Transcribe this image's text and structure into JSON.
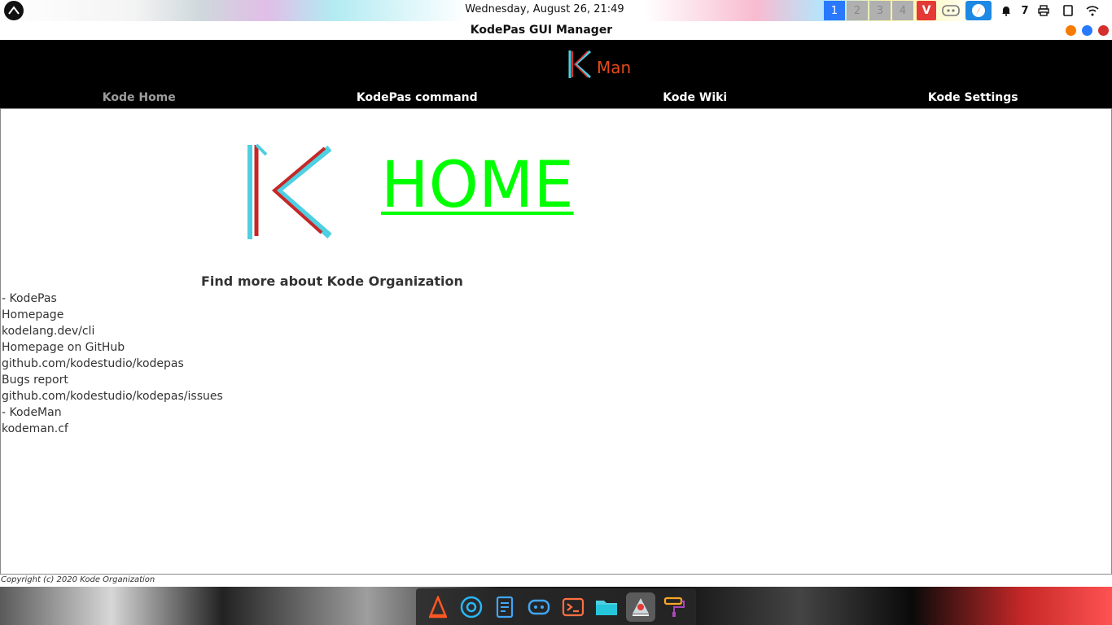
{
  "system_panel": {
    "clock": "Wednesday, August 26, 21:49",
    "workspaces": [
      "1",
      "2",
      "3",
      "4"
    ],
    "active_workspace": "1",
    "notification_count": "7",
    "icons": [
      "os-logo-icon",
      "vivaldi-icon",
      "discord-icon",
      "browser-icon",
      "notification-bell-icon",
      "printer-icon",
      "tablet-icon",
      "wifi-icon",
      "music-icon"
    ]
  },
  "window": {
    "title": "KodePas GUI Manager",
    "buttons": {
      "minimize_color": "#f57c00",
      "maximize_color": "#2979ff",
      "close_color": "#d32f2f"
    }
  },
  "app": {
    "header_logo_text": "Man",
    "nav": [
      {
        "label": "Kode Home",
        "current": true
      },
      {
        "label": "KodePas command",
        "current": false
      },
      {
        "label": "Kode Wiki",
        "current": false
      },
      {
        "label": "Kode Settings",
        "current": false
      }
    ],
    "hero_title": "HOME",
    "hero_title_color": "#00ff00",
    "links_heading": "Find more about Kode Organization",
    "lines": [
      {
        "text": "- KodePas",
        "link": false
      },
      {
        "text": "Homepage",
        "link": false
      },
      {
        "text": "kodelang.dev/cli",
        "link": true
      },
      {
        "text": "Homepage on GitHub",
        "link": false
      },
      {
        "text": "github.com/kodestudio/kodepas",
        "link": true
      },
      {
        "text": "Bugs report",
        "link": false
      },
      {
        "text": "github.com/kodestudio/kodepas/issues",
        "link": true
      },
      {
        "text": "- KodeMan",
        "link": false
      },
      {
        "text": "kodeman.cf",
        "link": true
      }
    ],
    "footer": "Copyright (c) 2020 Kode Organization"
  },
  "dock": {
    "items": [
      "vlc-icon",
      "chrome-icon",
      "text-editor-icon",
      "discord-icon",
      "terminal-icon",
      "files-icon",
      "kodeman-app-icon",
      "paint-roller-icon"
    ],
    "active_item": "kodeman-app-icon"
  }
}
